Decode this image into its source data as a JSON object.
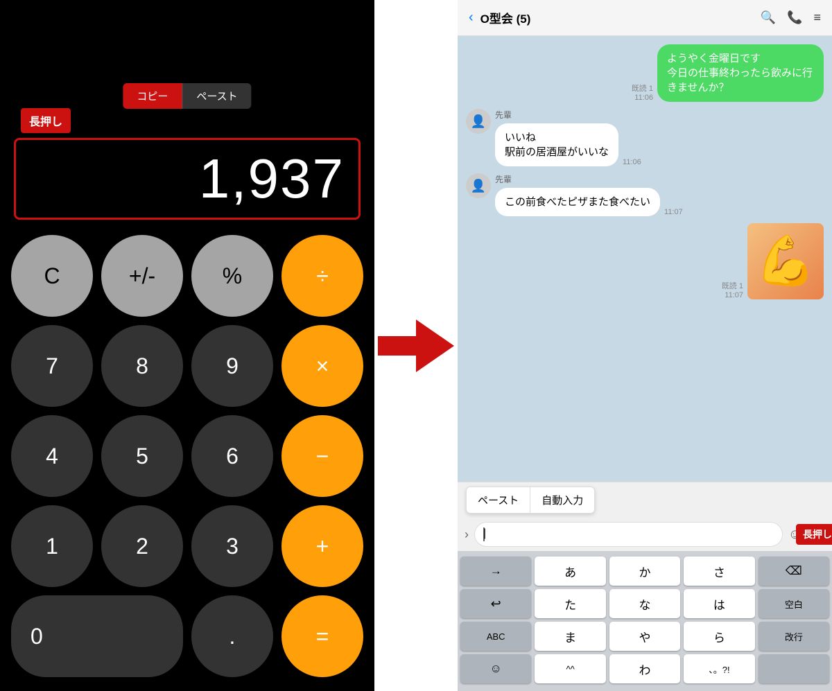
{
  "calculator": {
    "display": "1,937",
    "copy_label": "コピー",
    "paste_label": "ペースト",
    "nagaoshi_label": "長押し",
    "buttons": [
      {
        "label": "C",
        "type": "gray"
      },
      {
        "label": "+/-",
        "type": "gray"
      },
      {
        "label": "%",
        "type": "gray"
      },
      {
        "label": "÷",
        "type": "orange"
      },
      {
        "label": "7",
        "type": "dark"
      },
      {
        "label": "8",
        "type": "dark"
      },
      {
        "label": "9",
        "type": "dark"
      },
      {
        "label": "×",
        "type": "orange"
      },
      {
        "label": "4",
        "type": "dark"
      },
      {
        "label": "5",
        "type": "dark"
      },
      {
        "label": "6",
        "type": "dark"
      },
      {
        "label": "−",
        "type": "orange"
      },
      {
        "label": "1",
        "type": "dark"
      },
      {
        "label": "2",
        "type": "dark"
      },
      {
        "label": "3",
        "type": "dark"
      },
      {
        "label": "+",
        "type": "orange"
      },
      {
        "label": "0",
        "type": "dark",
        "zero": true
      },
      {
        "label": ".",
        "type": "dark"
      },
      {
        "label": "=",
        "type": "orange"
      }
    ]
  },
  "chat": {
    "header": {
      "title": "O型会 (5)",
      "back_icon": "‹"
    },
    "messages": [
      {
        "sender": "self",
        "text": "ようやく金曜日です\n今日の仕事終わったら飲みに行きませんか？",
        "meta": "既読 1\n11:06"
      },
      {
        "sender": "senpai",
        "sender_label": "先輩",
        "text": "いいね\n駅前の居酒屋がいいな",
        "meta": "11:06"
      },
      {
        "sender": "senpai",
        "sender_label": "先輩",
        "text": "この前食べたピザまた食べたい",
        "meta": "11:07"
      },
      {
        "sender": "sticker",
        "meta": "既読 1\n11:07"
      }
    ],
    "paste_menu": {
      "paste_label": "ペースト",
      "auto_input_label": "自動入力"
    },
    "input_area": {
      "nagaoshi_label": "長押し"
    },
    "keyboard": {
      "rows": [
        [
          "→",
          "あ",
          "か",
          "さ",
          "⌫"
        ],
        [
          "↩",
          "た",
          "な",
          "は",
          "空白"
        ],
        [
          "ABC",
          "ま",
          "や",
          "ら",
          "改行"
        ],
        [
          "☺",
          "^^",
          "わ",
          "、。?!",
          ""
        ]
      ]
    }
  }
}
